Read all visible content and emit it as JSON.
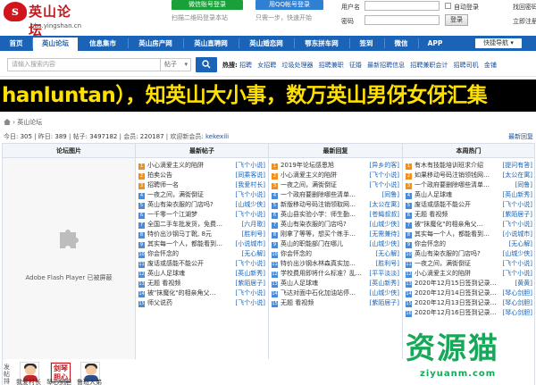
{
  "header": {
    "logo_cn": "英山论坛",
    "logo_badge": "s",
    "logo_url": "bbs.yingshan.cn",
    "wechat_label": "微信账号登录",
    "qr_tip": "扫描二维码登录本站",
    "qq_label": "用QQ帐号登录",
    "qq_tip": "只需一步，快速开始",
    "login": {
      "username_label": "用户名",
      "password_label": "密码",
      "auto_login": "自动登录",
      "find_password": "找回密码",
      "register": "立即注册",
      "login_button": "登录"
    }
  },
  "nav": {
    "items": [
      "首页",
      "英山论坛",
      "信息集市",
      "英山房产网",
      "英山直聘网",
      "英山婚恋网",
      "鄂东拼车网",
      "签到",
      "微信",
      "APP"
    ],
    "quick": "快捷导航"
  },
  "search": {
    "placeholder": "请输入搜索内容",
    "category": "帖子",
    "hot_label": "热搜:",
    "hot_links": [
      "招聘",
      "女招聘",
      "垃圾处理器",
      "招聘兼职",
      "征婚",
      "最新招聘信息",
      "招聘兼职会计",
      "招聘司机",
      "金铺"
    ]
  },
  "banner": {
    "text": "hanluntan），知英山大小事，数万英山男伢女伢汇集"
  },
  "breadcrumb": {
    "current": "英山论坛"
  },
  "stats": {
    "today_label": "今日:",
    "today": "305",
    "yesterday_label": "昨日:",
    "yesterday": "389",
    "posts_label": "帖子:",
    "posts": "3497182",
    "members_label": "会员:",
    "members": "220187",
    "welcome_label": "欢迎新会员:",
    "new_member": "kekexili",
    "latest_reply": "最新回复"
  },
  "columns": {
    "forum_pic": "论坛图片",
    "newest": "最新帖子",
    "reply": "最新回复",
    "hot": "本周热门"
  },
  "flash": {
    "text": "Adobe Flash Player 已被屏蔽"
  },
  "lists": {
    "newest": [
      {
        "title": "小心滴爱主义的陷阱",
        "author": "[飞个小说]"
      },
      {
        "title": "拍卖公告",
        "author": "[同乘客说]"
      },
      {
        "title": "招聘师一名",
        "author": "[我爱村长]"
      },
      {
        "title": "一夜之间，满街倒证",
        "author": "[飞个小说]"
      },
      {
        "title": "英山有染衣服的门店吗?",
        "author": "[山城少侠]"
      },
      {
        "title": "一千零一个江湖梦",
        "author": "[飞个小说]"
      },
      {
        "title": "全国二手车批发货，免费…",
        "author": "[六月歌]"
      },
      {
        "title": "特价出沙钢马丁靴, 8元",
        "author": "[胜利号]"
      },
      {
        "title": "其实每一个人，都能看到…",
        "author": "[小说城市]"
      },
      {
        "title": "你会怀念的",
        "author": "[无心解]"
      },
      {
        "title": "废话或感能不能公开",
        "author": "[飞个小说]"
      },
      {
        "title": "英山人足球魂",
        "author": "[英山新秀]"
      },
      {
        "title": "无题 看视频",
        "author": "[紫陌居子]"
      },
      {
        "title": "被\"抹魔化\"的相亲角父…",
        "author": "[飞个小说]"
      },
      {
        "title": "师父说药",
        "author": "[飞个小说]"
      }
    ],
    "reply": [
      {
        "title": "2019年论坛感恩旭",
        "author": "[异乡的客]"
      },
      {
        "title": "小心滴爱主义的陷阱",
        "author": "[飞个小说]"
      },
      {
        "title": "一夜之间，满街倒证",
        "author": "[飞个小说]"
      },
      {
        "title": "一个政府要删除哪些清单…",
        "author": "[同鲁]"
      },
      {
        "title": "新版移动号码注销领取网…",
        "author": "[太公在寓]"
      },
      {
        "title": "英山县实验小学：师生勤…",
        "author": "[苍蝇叔叔]"
      },
      {
        "title": "英山有染衣服的门店吗?",
        "author": "[山城少侠]"
      },
      {
        "title": "刚拿了等等，想买个练手…",
        "author": "[无需兼待]"
      },
      {
        "title": "英山的职能部门在哪儿",
        "author": "[山城少侠]"
      },
      {
        "title": "你会怀念的",
        "author": "[无心解]"
      },
      {
        "title": "特价出沙钢水林森真实加…",
        "author": "[胜利号]"
      },
      {
        "title": "学校费用即将什么标准？乱…",
        "author": "[平平淡淡]"
      },
      {
        "title": "英山人足球魂",
        "author": "[英山新秀]"
      },
      {
        "title": "飞达对面中石化加油站停…",
        "author": "[山城少侠]"
      },
      {
        "title": "无题 看视频",
        "author": "[紫陌居子]"
      }
    ],
    "hot": [
      {
        "title": "有木有技能培训班求介绍",
        "author": "[提问有答]"
      },
      {
        "title": "如果移动号码注销领钱网…",
        "author": "[太公在寓]"
      },
      {
        "title": "一个政府要删除哪些清单…",
        "author": "[同鲁]"
      },
      {
        "title": "英山人足球魂",
        "author": "[英山新秀]"
      },
      {
        "title": "废话或感能不能公开",
        "author": "[飞个小说]"
      },
      {
        "title": "无题 看视频",
        "author": "[紫陌居子]"
      },
      {
        "title": "被\"抹魔化\"的相亲角父…",
        "author": "[飞个小说]"
      },
      {
        "title": "其实每一个人，都能看到…",
        "author": "[小说城市]"
      },
      {
        "title": "你会怀念的",
        "author": "[无心解]"
      },
      {
        "title": "英山有染衣服的门店吗?",
        "author": "[山城少侠]"
      },
      {
        "title": "一夜之间，满街倒证",
        "author": "[飞个小说]"
      },
      {
        "title": "小心滴爱主义的陷阱",
        "author": "[飞个小说]"
      },
      {
        "title": "2020年12月15日签到记录…",
        "author": "[黄黄]"
      },
      {
        "title": "2020年12月14日签到记录…",
        "author": "[琴心剑胆]"
      },
      {
        "title": "2020年12月13日签到记录…",
        "author": "[琴心剑胆]"
      },
      {
        "title": "2020年12月16日签到记录…",
        "author": "[琴心剑胆]"
      }
    ]
  },
  "ranking": {
    "side_label": "发帖排行",
    "members": [
      "我爱村长",
      "琴心剑胆",
      "鲁班大弟"
    ],
    "stamp_text": "剑琴胆心"
  },
  "watermark": {
    "cn": "资源猫",
    "url": "ziyuanm.com"
  },
  "colors": {
    "nav_blue": "#1a63b7",
    "brand_red": "#c3181e",
    "banner_yellow": "#ffe000",
    "badge_orange": "#f09023",
    "watermark_green": "#17a85a"
  }
}
